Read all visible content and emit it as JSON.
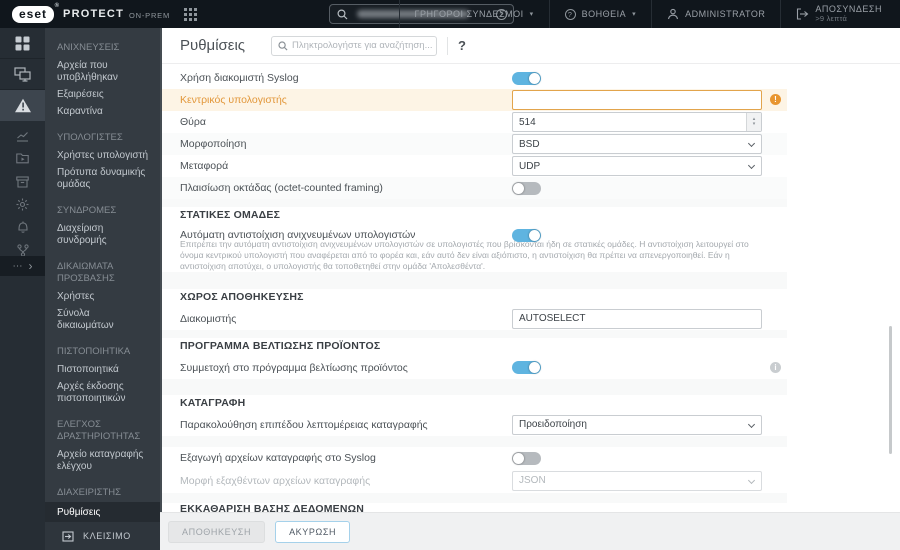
{
  "header": {
    "logo_text": "eset",
    "product": "PROTECT",
    "edition": "ON-PREM",
    "quick_links": "ΓΡΗΓΟΡΟΙ ΣΥΝΔΕΣΜΟΙ",
    "help": "ΒΟΗΘΕΙΑ",
    "user": "ADMINISTRATOR",
    "logout": "ΑΠΟΣΥΝΔΕΣΗ",
    "logout_sub": ">9 λεπτά"
  },
  "sidebar": {
    "collapse": "ΚΛΕΙΣΙΜΟ",
    "sections": [
      {
        "title": "ΑΝΙΧΝΕΥΣΕΙΣ",
        "items": [
          "Αρχεία που υποβλήθηκαν",
          "Εξαιρέσεις",
          "Καραντίνα"
        ]
      },
      {
        "title": "ΥΠΟΛΟΓΙΣΤΕΣ",
        "items": [
          "Χρήστες υπολογιστή",
          "Πρότυπα δυναμικής ομάδας"
        ]
      },
      {
        "title": "ΣΥΝΔΡΟΜΕΣ",
        "items": [
          "Διαχείριση συνδρομής"
        ]
      },
      {
        "title": "ΔΙΚΑΙΩΜΑΤΑ ΠΡΟΣΒΑΣΗΣ",
        "items": [
          "Χρήστες",
          "Σύνολα δικαιωμάτων"
        ]
      },
      {
        "title": "ΠΙΣΤΟΠΟΙΗΤΙΚΑ",
        "items": [
          "Πιστοποιητικά",
          "Αρχές έκδοσης πιστοποιητικών"
        ]
      },
      {
        "title": "ΕΛΕΓΧΟΣ ΔΡΑΣΤΗΡΙΟΤΗΤΑΣ",
        "items": [
          "Αρχείο καταγραφής ελέγχου"
        ]
      },
      {
        "title": "ΔΙΑΧΕΙΡΙΣΤΗΣ",
        "items": [
          "Ρυθμίσεις"
        ],
        "selected": "Ρυθμίσεις"
      }
    ]
  },
  "page": {
    "title": "Ρυθμίσεις",
    "search_placeholder": "Πληκτρολογήστε για αναζήτηση...",
    "help_glyph": "?"
  },
  "settings": {
    "syslog": {
      "use_label": "Χρήση διακομιστή Syslog",
      "use_value": true,
      "host_label": "Κεντρικός υπολογιστής",
      "host_value": "",
      "host_invalid": true,
      "port_label": "Θύρα",
      "port_value": "514",
      "format_label": "Μορφοποίηση",
      "format_value": "BSD",
      "transport_label": "Μεταφορά",
      "transport_value": "UDP",
      "framing_label": "Πλαισίωση οκτάδας (octet-counted framing)",
      "framing_value": false
    },
    "static_groups": {
      "title": "ΣΤΑΤΙΚΕΣ ΟΜΑΔΕΣ",
      "pairing_label": "Αυτόματη αντιστοίχιση ανιχνευμένων υπολογιστών",
      "pairing_value": true,
      "description": "Επιτρέπει την αυτόματη αντιστοίχιση ανιχνευμένων υπολογιστών σε υπολογιστές που βρίσκονται ήδη σε στατικές ομάδες. Η αντιστοίχιση λειτουργεί στο όνομα κεντρικού υπολογιστή που αναφέρεται από το φορέα και, εάν αυτό δεν είναι αξιόπιστο, η αντιστοίχιση θα πρέπει να απενεργοποιηθεί. Εάν η αντιστοίχιση αποτύχει, ο υπολογιστής θα τοποθετηθεί στην ομάδα 'Απολεσθέντα'."
    },
    "repository": {
      "title": "ΧΩΡΟΣ ΑΠΟΘΗΚΕΥΣΗΣ",
      "server_label": "Διακομιστής",
      "server_value": "AUTOSELECT"
    },
    "improvement": {
      "title": "ΠΡΟΓΡΑΜΜΑ ΒΕΛΤΙΩΣΗΣ ΠΡΟΪΟΝΤΟΣ",
      "participate_label": "Συμμετοχή στο πρόγραμμα βελτίωσης προϊόντος",
      "participate_value": true
    },
    "logging": {
      "title": "ΚΑΤΑΓΡΑΦΗ",
      "verbosity_label": "Παρακολούθηση επιπέδου λεπτομέρειας καταγραφής",
      "verbosity_value": "Προειδοποίηση",
      "export_label": "Εξαγωγή αρχείων καταγραφής στο Syslog",
      "export_value": false,
      "format_label": "Μορφή εξαχθέντων αρχείων καταγραφής",
      "format_value": "JSON",
      "format_disabled": true
    },
    "cleanup": {
      "title": "ΕΚΚΑΘΑΡΙΣΗ ΒΑΣΗΣ ΔΕΔΟΜΕΝΩΝ"
    }
  },
  "footer": {
    "save": "ΑΠΟΘΗΚΕΥΣΗ",
    "cancel": "ΑΚΥΡΩΣΗ"
  },
  "colors": {
    "toggle_on": "#5fb4e0",
    "warning": "#e8952f",
    "highlight_row": "#fdf4e5",
    "highlight_border": "#e2a44c",
    "header_bg": "#10161c",
    "iconbar_bg": "#262d34",
    "menu_bg": "#343b42"
  },
  "icons": [
    "eset-logo",
    "app-grid-icon",
    "search-icon",
    "help-circle-icon",
    "chevron-down-icon",
    "user-icon",
    "logout-icon",
    "dashboard-icon",
    "computers-icon",
    "detections-icon",
    "reports-icon",
    "tasks-icon",
    "installers-icon",
    "policies-icon",
    "notifications-icon",
    "status-overview-icon",
    "more-icon",
    "expand-icon",
    "collapse-icon",
    "warning-badge-icon",
    "info-badge-icon",
    "spinner-icon"
  ]
}
